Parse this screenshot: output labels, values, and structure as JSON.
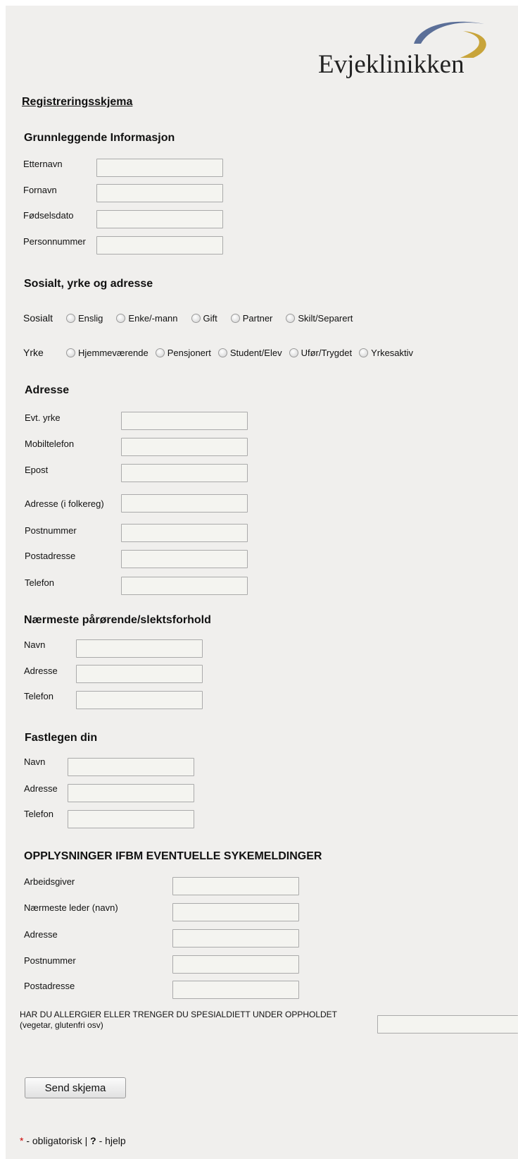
{
  "logo": {
    "text": "Evjeklinikken",
    "arc_blue": "#5b6f98",
    "arc_gold": "#c8a43a"
  },
  "form_title": "Registreringsskjema",
  "sections": {
    "basic": {
      "heading": "Grunnleggende Informasjon",
      "labels": [
        "Etternavn",
        "Fornavn",
        "Fødselsdato",
        "Personnummer"
      ]
    },
    "social": {
      "heading": "Sosialt, yrke og adresse",
      "sosialt_label": "Sosialt",
      "sosialt_options": [
        "Enslig",
        "Enke/-mann",
        "Gift",
        "Partner",
        "Skilt/Separert"
      ],
      "yrke_label": "Yrke",
      "yrke_options": [
        "Hjemmeværende",
        "Pensjonert",
        "Student/Elev",
        "Ufør/Trygdet",
        "Yrkesaktiv"
      ]
    },
    "address": {
      "heading": "Adresse",
      "labels": [
        "Evt. yrke",
        "Mobiltelefon",
        "Epost",
        "Adresse (i folkereg)",
        "Postnummer",
        "Postadresse",
        "Telefon"
      ]
    },
    "relative": {
      "heading": "Nærmeste pårørende/slektsforhold",
      "labels": [
        "Navn",
        "Adresse",
        "Telefon"
      ]
    },
    "gp": {
      "heading": "Fastlegen din",
      "labels": [
        "Navn",
        "Adresse",
        "Telefon"
      ]
    },
    "sick": {
      "heading": "OPPLYSNINGER IFBM EVENTUELLE SYKEMELDINGER",
      "labels": [
        "Arbeidsgiver",
        "Nærmeste leder (navn)",
        "Adresse",
        "Postnummer",
        "Postadresse"
      ]
    },
    "allergy": {
      "line1": "HAR DU ALLERGIER ELLER TRENGER DU SPESIALDIETT UNDER OPPHOLDET",
      "line2": "(vegetar, glutenfri osv)"
    }
  },
  "submit_label": "Send skjema",
  "footer": {
    "star": "*",
    "obligatorisk": " - obligatorisk | ",
    "q": "?",
    "hjelp": " - hjelp",
    "star_color": "#cc0000"
  }
}
